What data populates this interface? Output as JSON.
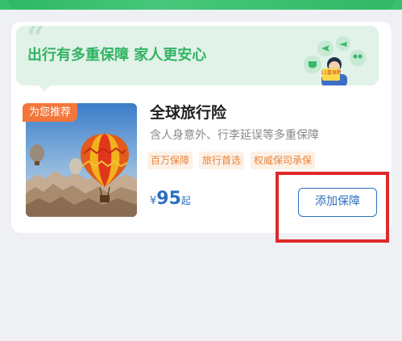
{
  "banner": {
    "text": "出行有多重保障 家人更安心",
    "illustration_badge": "11重保障"
  },
  "product": {
    "badge": "为您推荐",
    "title": "全球旅行险",
    "description": "含人身意外、行李延误等多重保障",
    "tags": [
      "百万保障",
      "旅行首选",
      "权威保司承保"
    ],
    "price": {
      "currency": "¥",
      "amount": "95",
      "suffix": "起"
    },
    "add_button_label": "添加保障"
  },
  "colors": {
    "accent_green": "#32b363",
    "price_blue": "#2b6fc1",
    "tag_orange": "#e8823a",
    "badge_orange": "#f4763a",
    "highlight_red": "#e02828"
  }
}
